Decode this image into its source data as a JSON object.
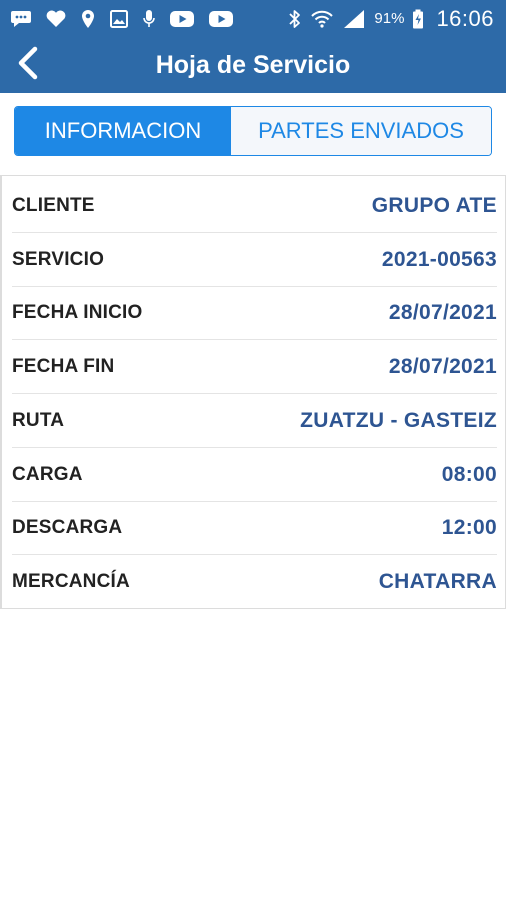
{
  "status_bar": {
    "battery_text": "91%",
    "time": "16:06",
    "icons": [
      "message-icon",
      "heart-icon",
      "location-icon",
      "image-icon",
      "mic-icon",
      "youtube-icon",
      "youtube-icon",
      "bluetooth-icon",
      "wifi-icon",
      "signal-icon",
      "battery-icon"
    ]
  },
  "header": {
    "title": "Hoja de Servicio",
    "back_icon": "chevron-left-icon"
  },
  "tabs": [
    {
      "label": "INFORMACION",
      "active": true
    },
    {
      "label": "PARTES ENVIADOS",
      "active": false
    }
  ],
  "info": {
    "rows": [
      {
        "label": "CLIENTE",
        "value": "GRUPO ATE"
      },
      {
        "label": "SERVICIO",
        "value": "2021-00563"
      },
      {
        "label": "FECHA INICIO",
        "value": "28/07/2021"
      },
      {
        "label": "FECHA FIN",
        "value": "28/07/2021"
      },
      {
        "label": "RUTA",
        "value": "ZUATZU - GASTEIZ"
      },
      {
        "label": "CARGA",
        "value": "08:00"
      },
      {
        "label": "DESCARGA",
        "value": "12:00"
      },
      {
        "label": "MERCANCÍA",
        "value": "CHATARRA"
      }
    ]
  },
  "colors": {
    "app_bar": "#2d6aa8",
    "tab_active_bg": "#1e88e5",
    "tab_inactive_bg": "#f4f7fb",
    "value_text": "#2e5592",
    "label_text": "#222222"
  }
}
